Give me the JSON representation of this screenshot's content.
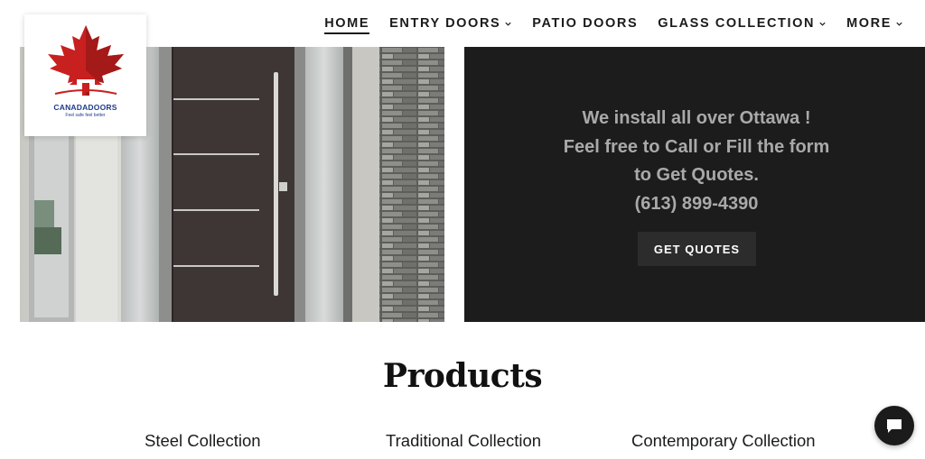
{
  "header": {
    "logo": {
      "name": "CANADADOORS",
      "tagline": "Feel safe feel better"
    },
    "nav": [
      {
        "label": "HOME",
        "active": true,
        "dropdown": false
      },
      {
        "label": "ENTRY DOORS",
        "active": false,
        "dropdown": true
      },
      {
        "label": "PATIO DOORS",
        "active": false,
        "dropdown": false
      },
      {
        "label": "GLASS COLLECTION",
        "active": false,
        "dropdown": true
      },
      {
        "label": "MORE",
        "active": false,
        "dropdown": true
      }
    ]
  },
  "hero": {
    "lines": [
      "We install all over Ottawa !",
      "Feel free to Call or Fill the form",
      "to Get Quotes.",
      "(613) 899-4390"
    ],
    "button_label": "GET QUOTES"
  },
  "products": {
    "title": "Products",
    "collections": [
      "Steel Collection",
      "Traditional Collection",
      "Contemporary Collection"
    ]
  },
  "colors": {
    "accent_red": "#c8201f",
    "brand_blue": "#1f3b8a",
    "panel_dark": "#1c1c1c",
    "hero_text": "#a9a9a9"
  },
  "icons": {
    "logo": "maple-leaf-house-icon",
    "chat": "chat-bubble-icon",
    "dropdown": "chevron-down-icon"
  }
}
